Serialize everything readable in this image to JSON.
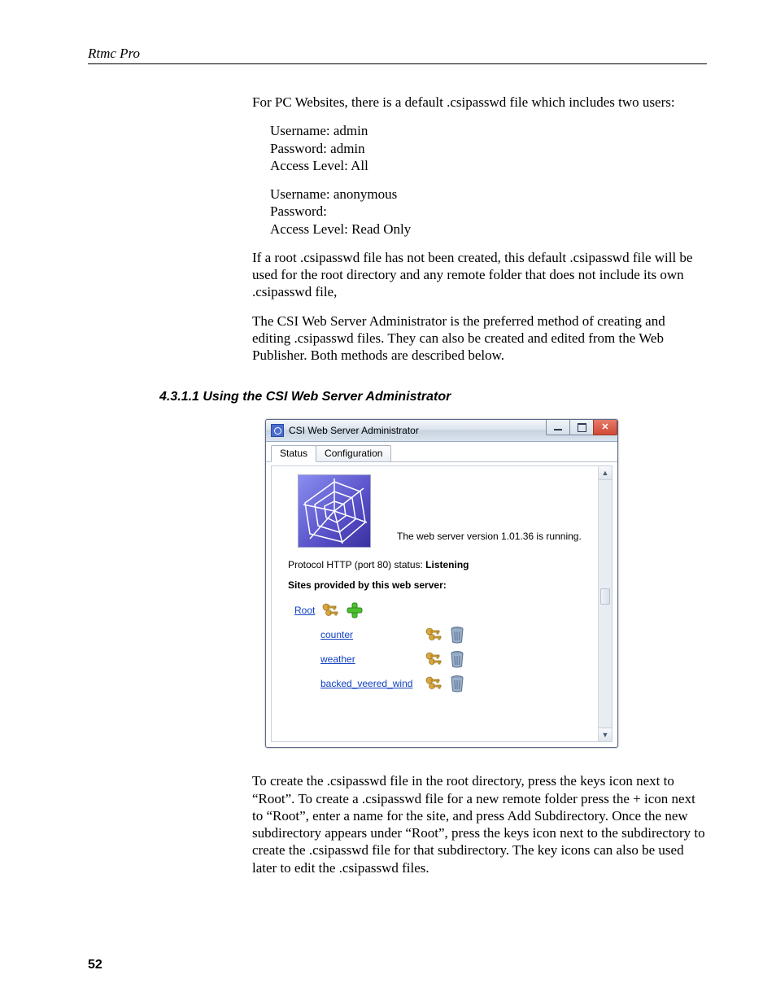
{
  "header": {
    "running_head": "Rtmc Pro"
  },
  "body": {
    "p1": "For PC Websites, there is a default .csipasswd file which includes two users:",
    "cred1": {
      "l1": "Username:  admin",
      "l2": "Password:  admin",
      "l3": "Access Level:  All"
    },
    "cred2": {
      "l1": "Username:  anonymous",
      "l2": "Password:",
      "l3": "Access Level:  Read Only"
    },
    "p2": "If a root .csipasswd file has not been created, this default .csipasswd file will be used for the root directory and any remote folder that does not include its own .csipasswd file,",
    "p3": "The CSI Web Server Administrator is the preferred method of creating and editing .csipasswd files. They can also be created and edited from the Web Publisher. Both methods are described below.",
    "heading": "4.3.1.1  Using the CSI Web Server Administrator",
    "p4": "To create the .csipasswd file in the root directory, press the keys icon next to “Root”. To create a .csipasswd file for a new remote folder press the + icon next to “Root”, enter a name for the site, and press Add Subdirectory. Once the new subdirectory appears under “Root”, press the keys icon next to the subdirectory to create the .csipasswd file for that subdirectory. The key icons can also be used later to edit the .csipasswd files."
  },
  "window": {
    "title": "CSI Web Server Administrator",
    "tabs": {
      "status": "Status",
      "configuration": "Configuration"
    },
    "version_text": "The web server version 1.01.36 is running.",
    "protocol_prefix": "Protocol HTTP (port 80) status: ",
    "protocol_status": "Listening",
    "sites_label": "Sites provided by this web server:",
    "root": "Root",
    "children": {
      "c0": "counter",
      "c1": "weather",
      "c2": "backed_veered_wind"
    }
  },
  "page_number": "52"
}
